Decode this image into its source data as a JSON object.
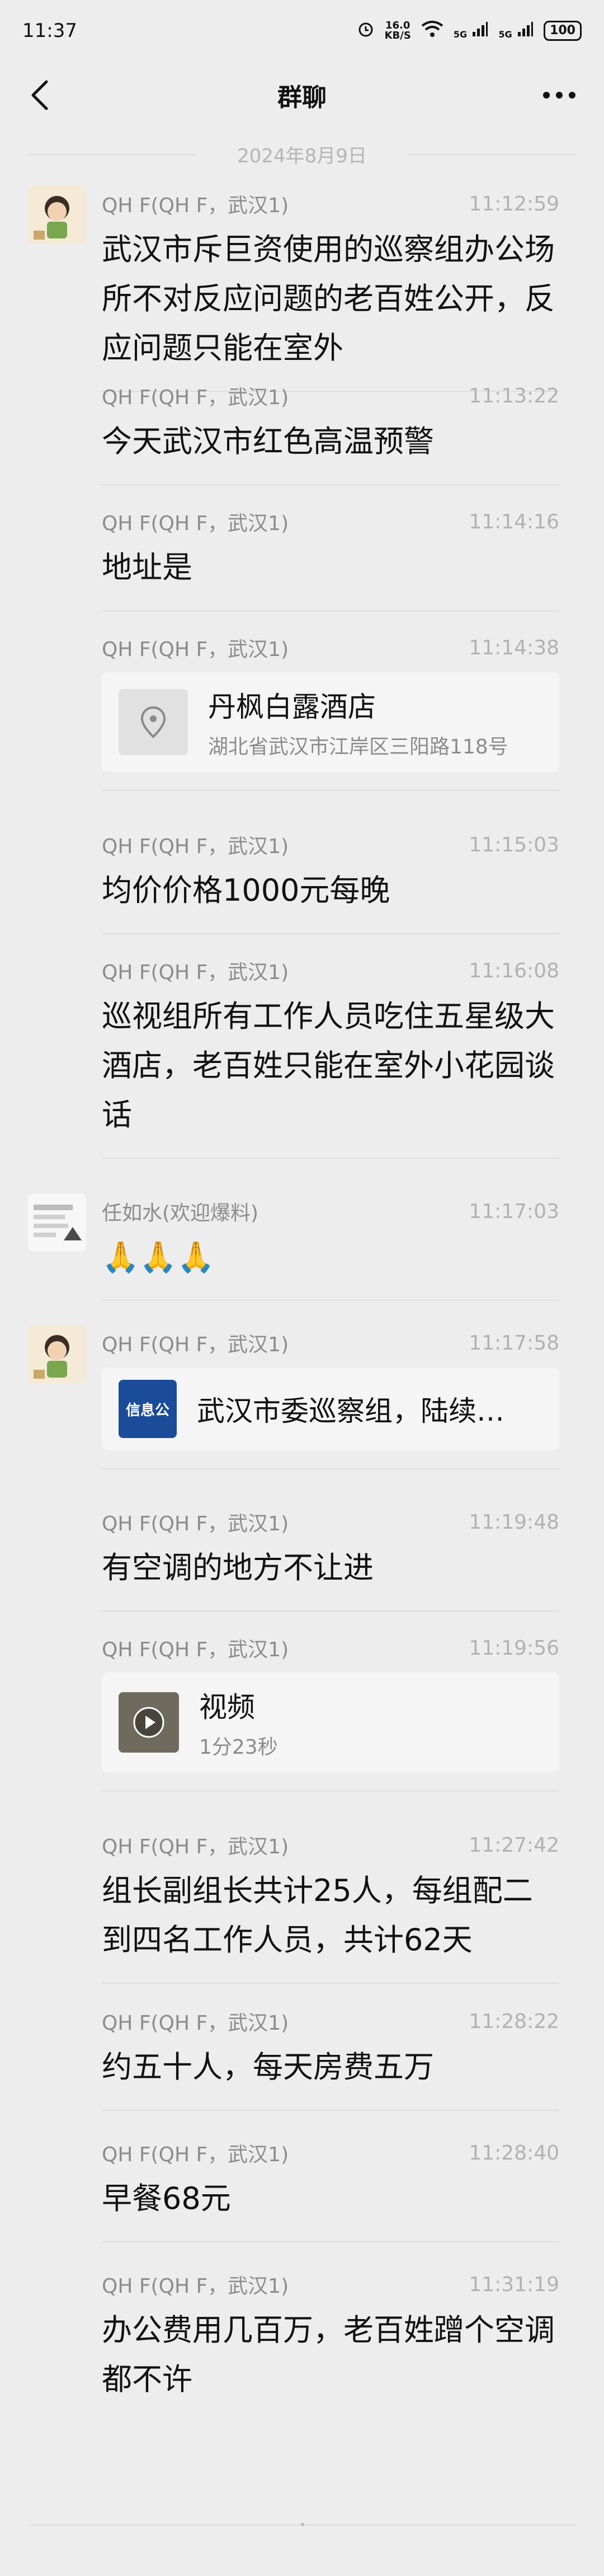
{
  "status_bar": {
    "time": "11:37",
    "network_speed": "16.0",
    "network_unit": "KB/S",
    "signal_a": "5G",
    "signal_b": "5G",
    "battery": "100"
  },
  "nav": {
    "title": "群聊"
  },
  "chat": {
    "date": "2024年8月9日",
    "messages": [
      {
        "name": "QH F(QH F，武汉1)",
        "time": "11:12:59",
        "text": "武汉市斥巨资使用的巡察组办公场所不对反应问题的老百姓公开，反应问题只能在室外",
        "show_avatar": true
      },
      {
        "name": "QH F(QH F，武汉1)",
        "time": "11:13:22",
        "text": "今天武汉市红色高温预警"
      },
      {
        "name": "QH F(QH F，武汉1)",
        "time": "11:14:16",
        "text": "地址是"
      },
      {
        "name": "QH F(QH F，武汉1)",
        "time": "11:14:38",
        "card_title": "丹枫白露酒店",
        "card_sub": "湖北省武汉市江岸区三阳路118号",
        "type": "location"
      },
      {
        "name": "QH F(QH F，武汉1)",
        "time": "11:15:03",
        "text": "均价价格1000元每晚"
      },
      {
        "name": "QH F(QH F，武汉1)",
        "time": "11:16:08",
        "text": "巡视组所有工作人员吃住五星级大酒店，老百姓只能在室外小花园谈话"
      },
      {
        "name": "任如水(欢迎爆料)",
        "time": "11:17:03",
        "text": "🙏🙏🙏",
        "show_avatar": true
      },
      {
        "name": "QH F(QH F，武汉1)",
        "time": "11:17:58",
        "card_title": "武汉市委巡察组，陆续…",
        "card_thumb_text": "信息公",
        "type": "link",
        "show_avatar": true
      },
      {
        "name": "QH F(QH F，武汉1)",
        "time": "11:19:48",
        "text": "有空调的地方不让进"
      },
      {
        "name": "QH F(QH F，武汉1)",
        "time": "11:19:56",
        "card_title": "视频",
        "card_sub": "1分23秒",
        "type": "video"
      },
      {
        "name": "QH F(QH F，武汉1)",
        "time": "11:27:42",
        "text": "组长副组长共计25人，每组配二到四名工作人员，共计62天"
      },
      {
        "name": "QH F(QH F，武汉1)",
        "time": "11:28:22",
        "text": "约五十人，每天房费五万"
      },
      {
        "name": "QH F(QH F，武汉1)",
        "time": "11:28:40",
        "text": "早餐68元"
      },
      {
        "name": "QH F(QH F，武汉1)",
        "time": "11:31:19",
        "text": "办公费用几百万，老百姓蹭个空调都不许"
      }
    ]
  }
}
